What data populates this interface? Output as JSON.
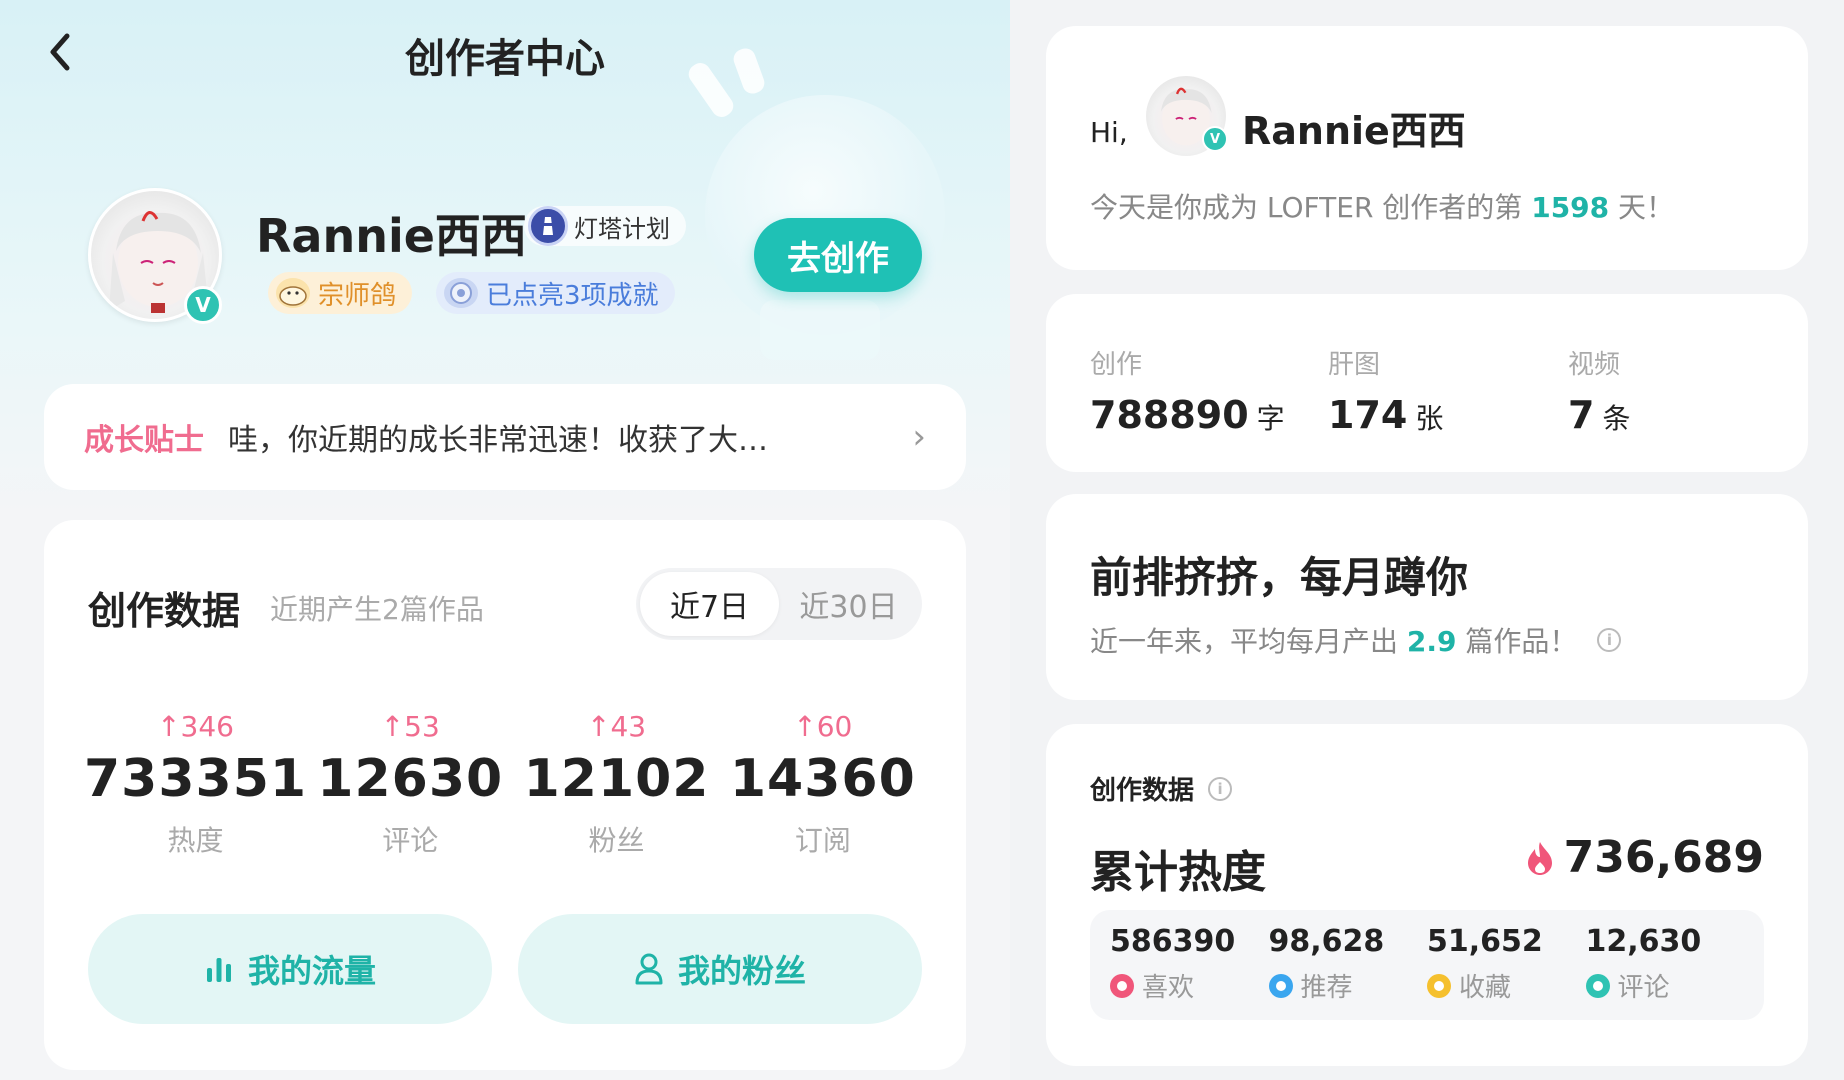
{
  "header": {
    "title": "创作者中心"
  },
  "profile": {
    "name": "Rannie西西",
    "plan_badge": "灯塔计划",
    "tags": [
      {
        "label": "宗师鸽",
        "icon": "pigeon-icon"
      },
      {
        "label": "已点亮3项成就",
        "icon": "achievement-icon"
      }
    ],
    "verified": "V",
    "create_button": "去创作"
  },
  "tip": {
    "label": "成长贴士",
    "text": "哇，你近期的成长非常迅速！收获了大…"
  },
  "creation_data": {
    "title": "创作数据",
    "subtitle": "近期产生2篇作品",
    "ranges": [
      "近7日",
      "近30日"
    ],
    "selected_range": "近7日",
    "stats": [
      {
        "delta": "↑346",
        "value": "733351",
        "label": "热度"
      },
      {
        "delta": "↑53",
        "value": "12630",
        "label": "评论"
      },
      {
        "delta": "↑43",
        "value": "12102",
        "label": "粉丝"
      },
      {
        "delta": "↑60",
        "value": "14360",
        "label": "订阅"
      }
    ],
    "buttons": [
      {
        "label": "我的流量",
        "icon": "bar-chart-icon"
      },
      {
        "label": "我的粉丝",
        "icon": "person-icon"
      }
    ]
  },
  "greeting": {
    "hi": "Hi,",
    "name": "Rannie西西",
    "days_prefix": "今天是你成为 LOFTER 创作者的第 ",
    "days": "1598",
    "days_suffix": " 天！"
  },
  "counts": [
    {
      "key": "创作",
      "value": "788890",
      "unit": "字"
    },
    {
      "key": "肝图",
      "value": "174",
      "unit": "张"
    },
    {
      "key": "视频",
      "value": "7",
      "unit": "条"
    }
  ],
  "monthly": {
    "slogan": "前排挤挤，每月蹲你",
    "prefix": "近一年来，平均每月产出 ",
    "avg": "2.9",
    "suffix": " 篇作品！"
  },
  "heat": {
    "section_title": "创作数据",
    "title": "累计热度",
    "total": "736,689",
    "breakdown": [
      {
        "value": "586390",
        "label": "喜欢",
        "color": "#f0567a"
      },
      {
        "value": "98,628",
        "label": "推荐",
        "color": "#3aa6ef"
      },
      {
        "value": "51,652",
        "label": "收藏",
        "color": "#f5c02e"
      },
      {
        "value": "12,630",
        "label": "评论",
        "color": "#2fc3b3"
      }
    ]
  },
  "colors": {
    "accent": "#1fc1b5",
    "pink": "#f06c8f"
  }
}
